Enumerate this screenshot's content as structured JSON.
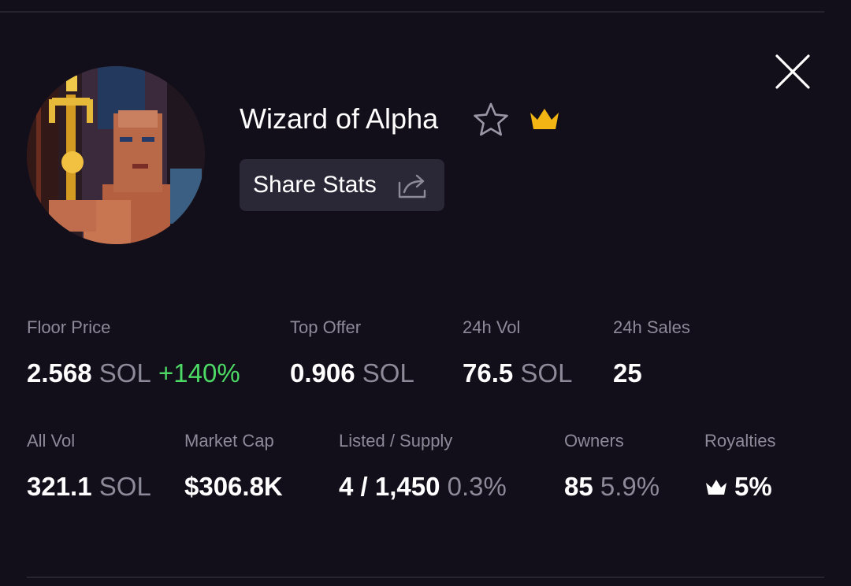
{
  "header": {
    "title": "Wizard of Alpha",
    "share_label": "Share Stats"
  },
  "icons": {
    "close": "close-icon",
    "favorite": "star-outline-icon",
    "verified": "crown-icon",
    "share": "share-arrow-icon",
    "royalty": "crown-icon"
  },
  "colors": {
    "background": "#120f1a",
    "crown": "#f2b514",
    "positive": "#4cd964",
    "muted": "#8d8a99"
  },
  "stats": {
    "floor_price": {
      "label": "Floor Price",
      "value": "2.568",
      "unit": "SOL",
      "change": "+140%"
    },
    "top_offer": {
      "label": "Top Offer",
      "value": "0.906",
      "unit": "SOL"
    },
    "vol_24h": {
      "label": "24h Vol",
      "value": "76.5",
      "unit": "SOL"
    },
    "sales_24h": {
      "label": "24h Sales",
      "value": "25"
    },
    "all_vol": {
      "label": "All Vol",
      "value": "321.1",
      "unit": "SOL"
    },
    "market_cap": {
      "label": "Market Cap",
      "value": "$306.8K"
    },
    "listed_supply": {
      "label": "Listed / Supply",
      "value": "4 / 1,450",
      "percent": "0.3%"
    },
    "owners": {
      "label": "Owners",
      "value": "85",
      "percent": "5.9%"
    },
    "royalties": {
      "label": "Royalties",
      "value": "5%"
    }
  }
}
